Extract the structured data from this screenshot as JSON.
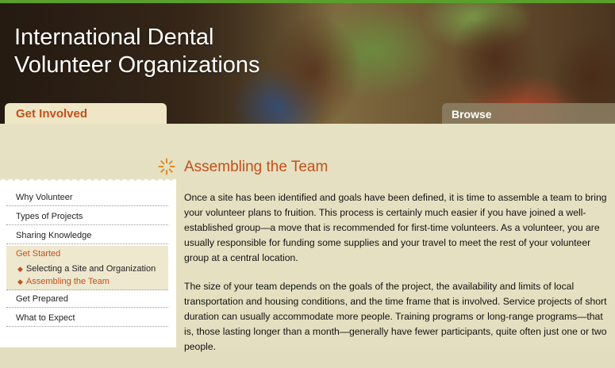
{
  "header": {
    "title_line1": "International Dental",
    "title_line2": "Volunteer Organizations"
  },
  "tabs": {
    "get_involved": "Get Involved",
    "browse": "Browse"
  },
  "sidebar": {
    "items": [
      {
        "label": "Why Volunteer"
      },
      {
        "label": "Types of Projects"
      },
      {
        "label": "Sharing Knowledge"
      },
      {
        "label": "Get Started"
      },
      {
        "label": "Get Prepared"
      },
      {
        "label": "What to Expect"
      }
    ],
    "sub_items": [
      {
        "label": "Selecting a Site and Organization"
      },
      {
        "label": "Assembling the Team"
      }
    ]
  },
  "main": {
    "heading": "Assembling the Team",
    "paragraphs": [
      "Once a site has been identified and goals have been defined, it is time to assemble a team to bring your volunteer plans to fruition. This process is certainly much easier if you have joined a well-established group—a move that is recommended for first-time volunteers. As a volunteer, you are usually responsible for funding some supplies and your travel to meet the rest of your volunteer group at a central location.",
      "The size of your team depends on the goals of the project, the availability and limits of local transportation and housing conditions, and the time frame that is involved. Service projects of short duration can usually accommodate more people. Training programs or long-range programs—that is, those lasting longer than a month—generally have fewer participants, quite often just one or two people."
    ]
  },
  "colors": {
    "accent": "#c3501a",
    "top_line": "#5a9e2c",
    "background": "#e3ddbf"
  },
  "icons": {
    "heading_icon": "sun-burst-icon",
    "sub_bullet": "diamond-bullet-icon"
  }
}
